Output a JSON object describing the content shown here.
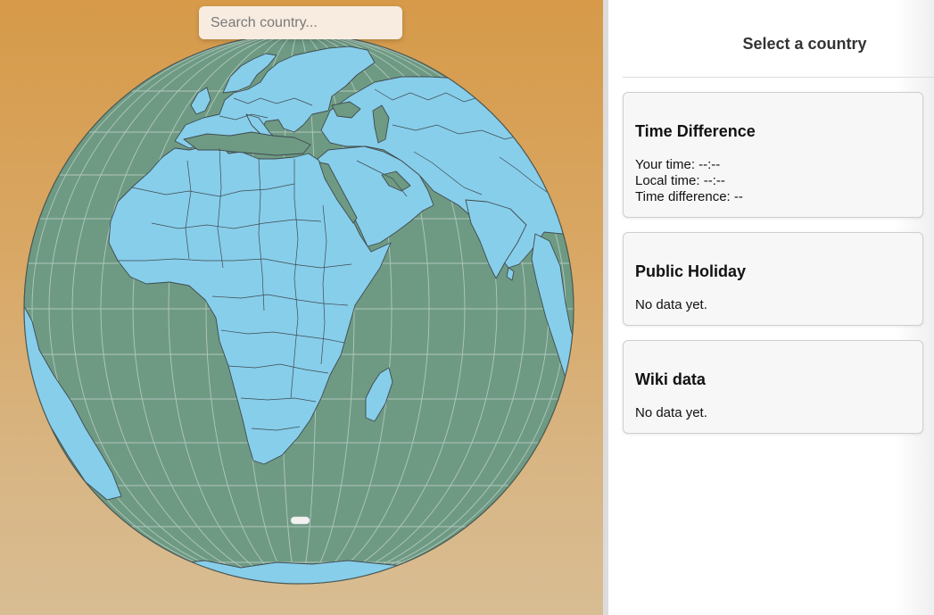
{
  "search": {
    "placeholder": "Search country..."
  },
  "panel": {
    "title": "Select a country",
    "time_card": {
      "heading": "Time Difference",
      "your_time": "Your time: --:--",
      "local_time": "Local time: --:--",
      "time_difference": "Time difference: --"
    },
    "holiday_card": {
      "heading": "Public Holiday",
      "body": "No data yet."
    },
    "wiki_card": {
      "heading": "Wiki data",
      "body": "No data yet."
    }
  },
  "colors": {
    "ocean": "#6e9a84",
    "land": "#87ceeb",
    "border": "#404a4e",
    "graticule": "#c9d6cf",
    "background_top": "#d69a49",
    "background_bottom": "#d8bd93"
  }
}
